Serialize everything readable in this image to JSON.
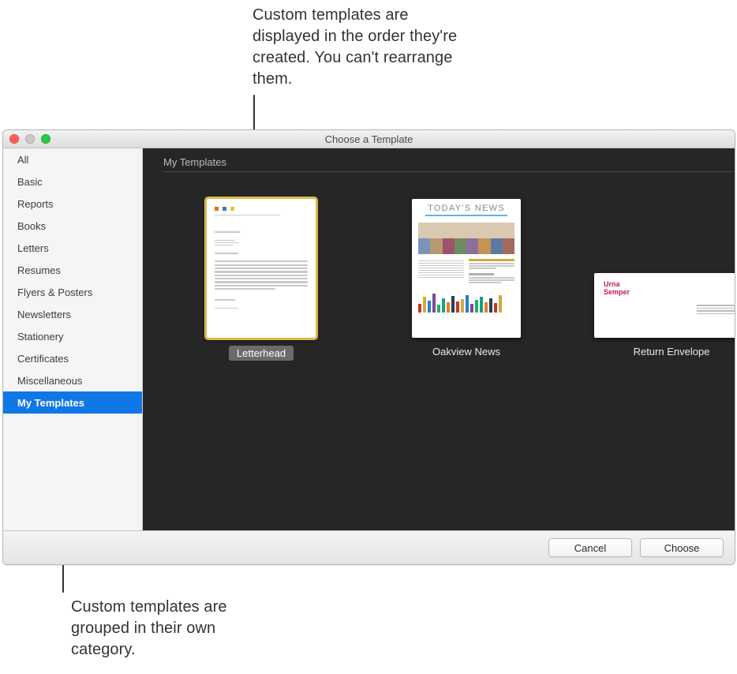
{
  "callouts": {
    "top": "Custom templates are displayed in the order they're created. You can't rearrange them.",
    "bottom": "Custom templates are grouped in their own category."
  },
  "window": {
    "title": "Choose a Template"
  },
  "sidebar": {
    "items": [
      {
        "label": "All"
      },
      {
        "label": "Basic"
      },
      {
        "label": "Reports"
      },
      {
        "label": "Books"
      },
      {
        "label": "Letters"
      },
      {
        "label": "Resumes"
      },
      {
        "label": "Flyers & Posters"
      },
      {
        "label": "Newsletters"
      },
      {
        "label": "Stationery"
      },
      {
        "label": "Certificates"
      },
      {
        "label": "Miscellaneous"
      },
      {
        "label": "My Templates"
      }
    ],
    "selected_index": 11
  },
  "main": {
    "section_title": "My Templates",
    "templates": [
      {
        "label": "Letterhead",
        "selected": true,
        "kind": "letterhead"
      },
      {
        "label": "Oakview News",
        "selected": false,
        "kind": "news"
      },
      {
        "label": "Return Envelope",
        "selected": false,
        "kind": "envelope"
      }
    ]
  },
  "footer": {
    "cancel": "Cancel",
    "choose": "Choose"
  },
  "thumb_text": {
    "news_masthead": "TODAY'S NEWS",
    "env_name1": "Urna",
    "env_name2": "Semper"
  }
}
